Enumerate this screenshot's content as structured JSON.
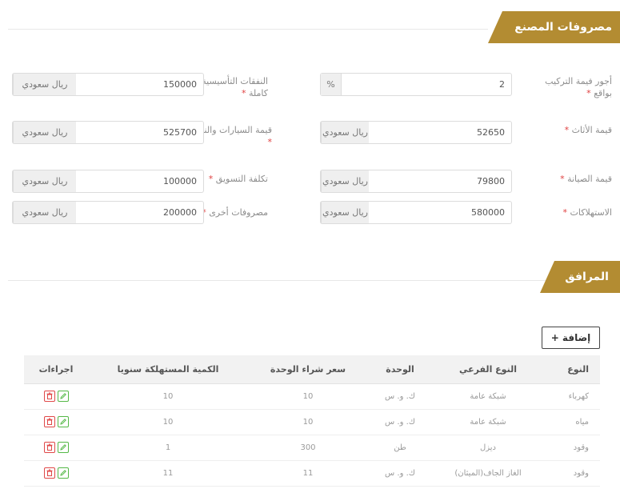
{
  "factory_expenses": {
    "title": "مصروفات المصنع",
    "fields": [
      {
        "label": "أجور فيمة التركيب بواقع",
        "value": "2",
        "unit": "%"
      },
      {
        "label": "النفقات التأسيسية كاملة",
        "value": "150000",
        "unit": "ريال سعودي"
      },
      {
        "label": "قيمة الأثاث",
        "value": "52650",
        "unit": "ريال سعودي"
      },
      {
        "label": "قيمة السيارات والنقل",
        "value": "525700",
        "unit": "ريال سعودي"
      },
      {
        "label": "قيمة الصيانة",
        "value": "79800",
        "unit": "ريال سعودي"
      },
      {
        "label": "تكلفة التسويق",
        "value": "100000",
        "unit": "ريال سعودي"
      },
      {
        "label": "الاستهلاكات",
        "value": "580000",
        "unit": "ريال سعودي"
      },
      {
        "label": "مصروفات أخرى",
        "value": "200000",
        "unit": "ريال سعودي"
      }
    ],
    "required_mark": "*"
  },
  "utilities": {
    "title": "المرافق",
    "add_button": "إضافة +",
    "columns": [
      "النوع",
      "النوع الفرعي",
      "الوحدة",
      "سعر شراء الوحدة",
      "الكمية المستهلكة سنويا",
      "اجراءات"
    ],
    "rows": [
      [
        "كهرباء",
        "شبكة عامة",
        "ك. و. س",
        "10",
        "10"
      ],
      [
        "مياه",
        "شبكة عامة",
        "ك. و. س",
        "10",
        "10"
      ],
      [
        "وقود",
        "ديزل",
        "طن",
        "300",
        "1"
      ],
      [
        "وقود",
        "الغاز الجاف(الميثان)",
        "ك. و. س",
        "11",
        "11"
      ]
    ],
    "action_icons": [
      "delete-icon",
      "edit-icon"
    ],
    "colors": {
      "delete": "#e04848",
      "edit": "#55b847"
    }
  },
  "colors": {
    "accent": "#b38c32"
  }
}
